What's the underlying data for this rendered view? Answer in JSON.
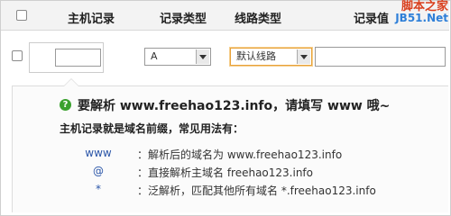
{
  "header": {
    "col_host": "主机记录",
    "col_type": "记录类型",
    "col_line": "线路类型",
    "col_value": "记录值"
  },
  "row": {
    "host_value": "",
    "type_value": "A",
    "line_value": "默认线路",
    "record_value": ""
  },
  "tip": {
    "title": "要解析 www.freehao123.info，请填写 www 哦~",
    "subtitle": "主机记录就是域名前缀，常见用法有：",
    "examples": [
      {
        "key": "www",
        "desc": "：解析后的域名为 www.freehao123.info"
      },
      {
        "key": "@",
        "desc": "：直接解析主域名 freehao123.info"
      },
      {
        "key": "*",
        "desc": "：泛解析，匹配其他所有域名 *.freehao123.info"
      }
    ]
  },
  "watermark": {
    "line1": "脚本之家",
    "line2": "JB51.Net"
  },
  "colors": {
    "accent": "#e8a23a",
    "link": "#2a55a8",
    "icon": "#3aa12e"
  }
}
